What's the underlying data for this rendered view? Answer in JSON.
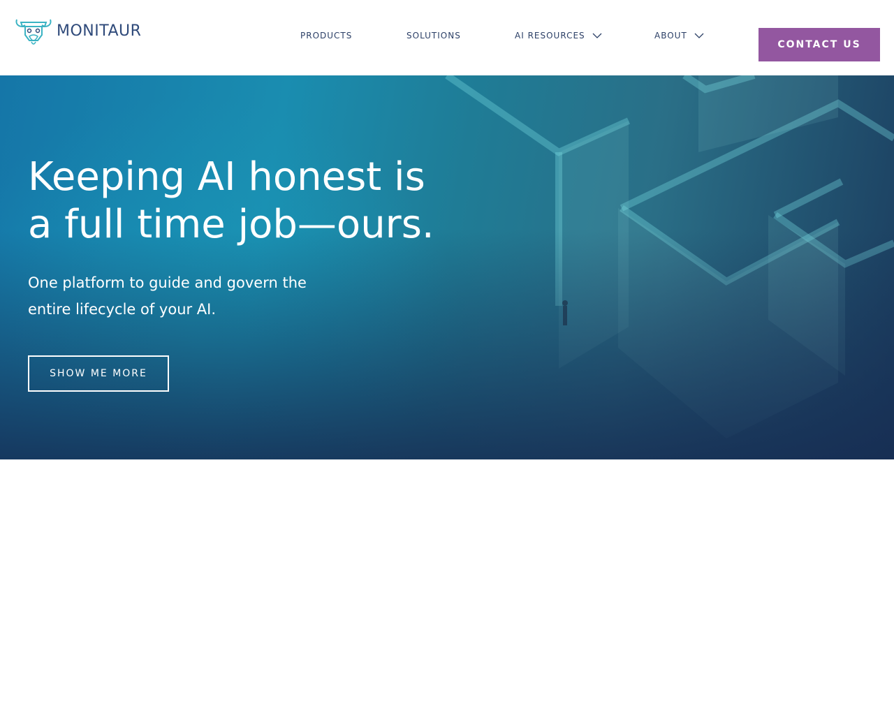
{
  "brand": {
    "name": "MONITAUR",
    "logo_icon": "bull-head-icon"
  },
  "nav": {
    "products": "PRODUCTS",
    "solutions": "SOLUTIONS",
    "ai_resources": "AI RESOURCES",
    "about": "ABOUT"
  },
  "header": {
    "contact_label": "CONTACT US"
  },
  "hero": {
    "title": "Keeping AI honest is a full time job—ours.",
    "subtitle": "One platform to guide and govern the entire lifecycle of your AI.",
    "cta_label": "SHOW ME MORE"
  },
  "colors": {
    "brand_text": "#2f4a7a",
    "nav_text": "#2b3f66",
    "accent_purple": "#9357a0",
    "hero_teal": "#1a8db0",
    "hero_navy": "#1b3c5e",
    "logo_teal": "#3bb3c3"
  }
}
